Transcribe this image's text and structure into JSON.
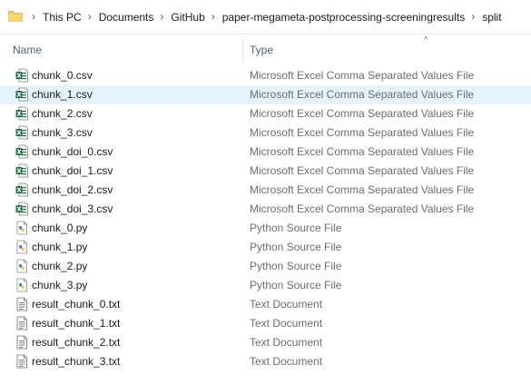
{
  "address_bar": {
    "breadcrumbs": [
      "This PC",
      "Documents",
      "GitHub",
      "paper-megameta-postprocessing-screeningresults",
      "split"
    ],
    "separator": "›"
  },
  "columns": {
    "name": "Name",
    "type": "Type",
    "sort_indicator": "^"
  },
  "files": [
    {
      "name": "chunk_0.csv",
      "type": "Microsoft Excel Comma Separated Values File",
      "icon": "excel-csv-icon",
      "selected": false
    },
    {
      "name": "chunk_1.csv",
      "type": "Microsoft Excel Comma Separated Values File",
      "icon": "excel-csv-icon",
      "selected": true
    },
    {
      "name": "chunk_2.csv",
      "type": "Microsoft Excel Comma Separated Values File",
      "icon": "excel-csv-icon",
      "selected": false
    },
    {
      "name": "chunk_3.csv",
      "type": "Microsoft Excel Comma Separated Values File",
      "icon": "excel-csv-icon",
      "selected": false
    },
    {
      "name": "chunk_doi_0.csv",
      "type": "Microsoft Excel Comma Separated Values File",
      "icon": "excel-csv-icon",
      "selected": false
    },
    {
      "name": "chunk_doi_1.csv",
      "type": "Microsoft Excel Comma Separated Values File",
      "icon": "excel-csv-icon",
      "selected": false
    },
    {
      "name": "chunk_doi_2.csv",
      "type": "Microsoft Excel Comma Separated Values File",
      "icon": "excel-csv-icon",
      "selected": false
    },
    {
      "name": "chunk_doi_3.csv",
      "type": "Microsoft Excel Comma Separated Values File",
      "icon": "excel-csv-icon",
      "selected": false
    },
    {
      "name": "chunk_0.py",
      "type": "Python Source File",
      "icon": "python-file-icon",
      "selected": false
    },
    {
      "name": "chunk_1.py",
      "type": "Python Source File",
      "icon": "python-file-icon",
      "selected": false
    },
    {
      "name": "chunk_2.py",
      "type": "Python Source File",
      "icon": "python-file-icon",
      "selected": false
    },
    {
      "name": "chunk_3.py",
      "type": "Python Source File",
      "icon": "python-file-icon",
      "selected": false
    },
    {
      "name": "result_chunk_0.txt",
      "type": "Text Document",
      "icon": "text-document-icon",
      "selected": false
    },
    {
      "name": "result_chunk_1.txt",
      "type": "Text Document",
      "icon": "text-document-icon",
      "selected": false
    },
    {
      "name": "result_chunk_2.txt",
      "type": "Text Document",
      "icon": "text-document-icon",
      "selected": false
    },
    {
      "name": "result_chunk_3.txt",
      "type": "Text Document",
      "icon": "text-document-icon",
      "selected": false
    }
  ],
  "colors": {
    "selection": "#e5f3ff",
    "excel_green": "#1d7044",
    "python_blue": "#3a78b5",
    "folder_yellow": "#f5c95b",
    "header_text": "#4c607a"
  }
}
